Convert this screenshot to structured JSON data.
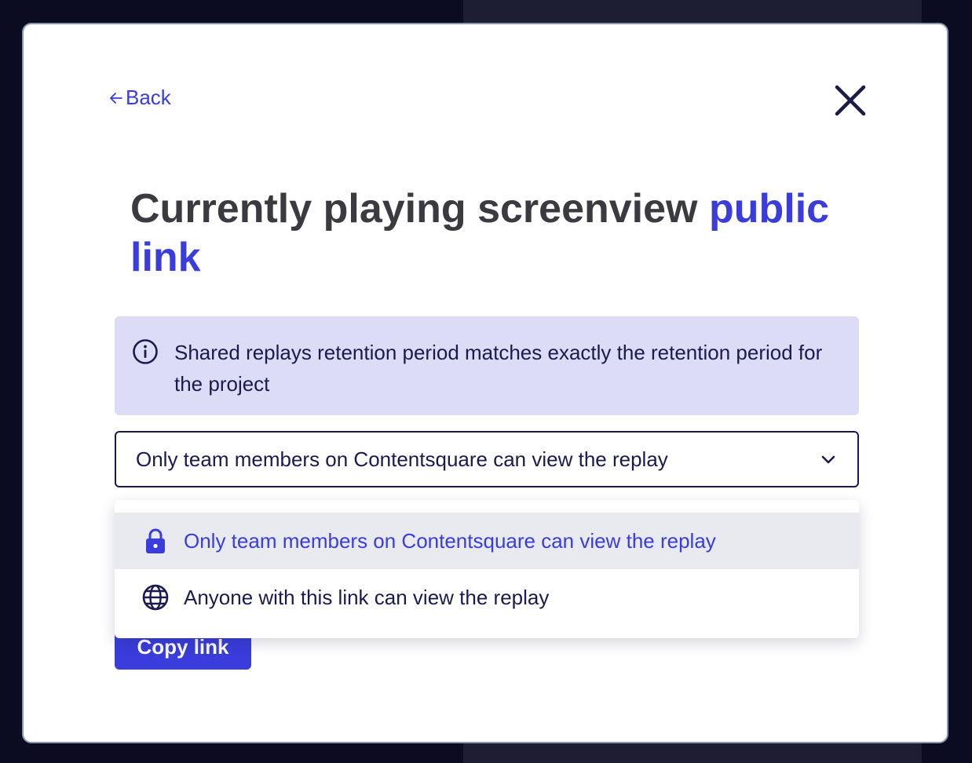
{
  "modal": {
    "back_label": "Back",
    "title_main": "Currently playing screenview",
    "title_accent": "public link",
    "info_text": "Shared replays retention period matches exactly the retention period for the project",
    "select_value": "Only team members on Contentsquare can view the replay",
    "copy_button_label": "Copy link",
    "options": [
      {
        "label": "Only team members on Contentsquare can view the replay",
        "icon": "lock-icon",
        "selected": true
      },
      {
        "label": "Anyone with this link can view the replay",
        "icon": "globe-icon",
        "selected": false
      }
    ]
  },
  "colors": {
    "accent": "#3a3ddb",
    "text_dark": "#1b1a4d",
    "info_bg": "#dcdcf7",
    "option_hover_bg": "#e8eaef"
  }
}
